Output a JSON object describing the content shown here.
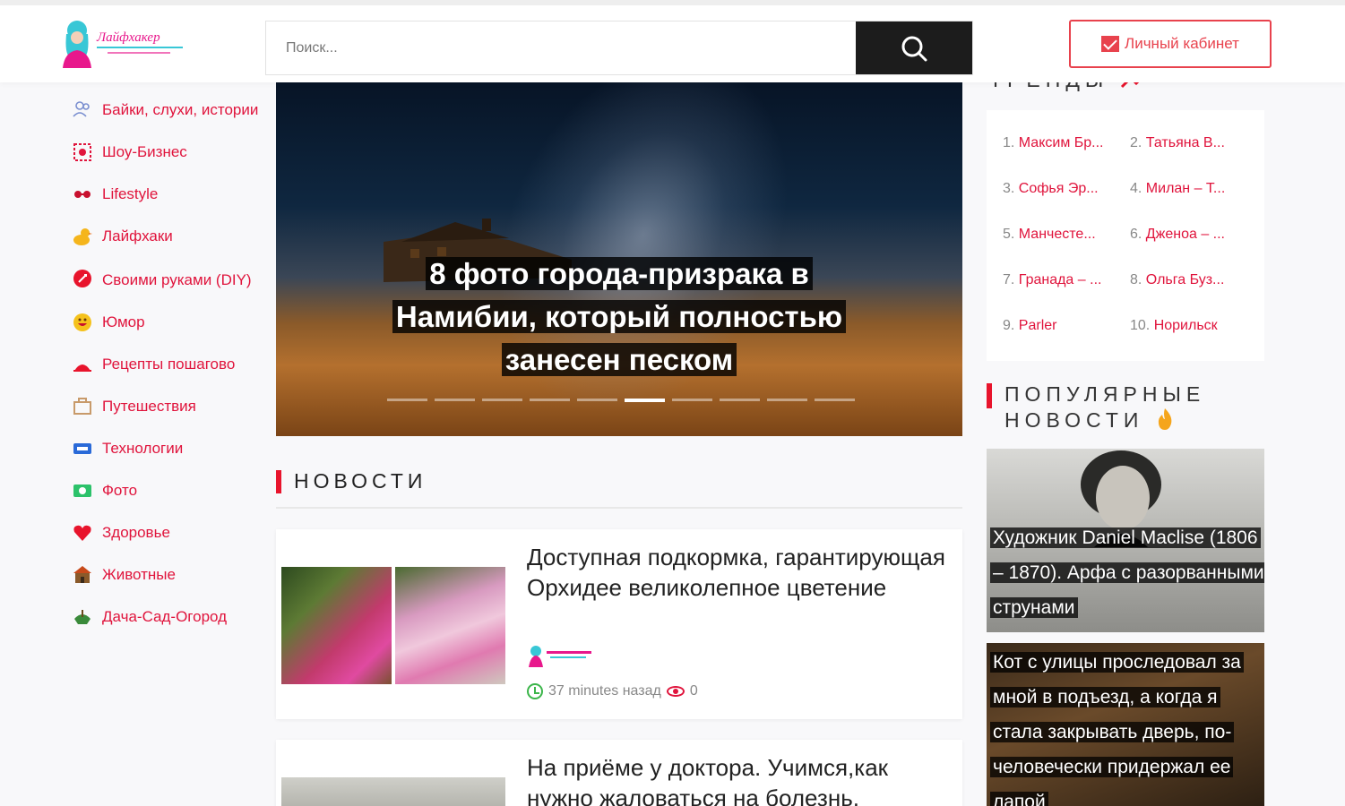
{
  "header": {
    "logo_text": "Лайфхакер",
    "search": {
      "placeholder": "Поиск..."
    },
    "cabinet_label": "Личный кабинет"
  },
  "sidebar": {
    "items": [
      {
        "label": "Байки, слухи, истории",
        "icon": "people-icon"
      },
      {
        "label": "Шоу-Бизнес",
        "icon": "show-icon"
      },
      {
        "label": "Lifestyle",
        "icon": "glasses-icon"
      },
      {
        "label": "Лайфхаки",
        "icon": "duck-icon"
      },
      {
        "label": "Своими руками (DIY)",
        "icon": "diy-icon"
      },
      {
        "label": "Юмор",
        "icon": "smile-icon"
      },
      {
        "label": "Рецепты пошагово",
        "icon": "recipe-icon"
      },
      {
        "label": "Путешествия",
        "icon": "travel-icon"
      },
      {
        "label": "Технологии",
        "icon": "tech-icon"
      },
      {
        "label": "Фото",
        "icon": "photo-icon"
      },
      {
        "label": "Здоровье",
        "icon": "heart-icon"
      },
      {
        "label": "Животные",
        "icon": "animal-icon"
      },
      {
        "label": "Дача-Сад-Огород",
        "icon": "garden-icon"
      }
    ]
  },
  "hero": {
    "title": "8 фото города-призрака в Намибии, который полностью занесен песком",
    "slides_count": 10,
    "active_slide": 6
  },
  "news": {
    "section_title": "НОВОСТИ",
    "items": [
      {
        "title": "Доступная подкормка, гарантирующая Орхидее великолепное цветение",
        "time": "37 minutes назад",
        "views": "0"
      },
      {
        "title": "На приёме у доктора. Учимся,как нужно жаловаться на болезнь,"
      }
    ]
  },
  "trends": {
    "title": "ТРЕНДЫ",
    "items": [
      {
        "num": "1.",
        "label": "Максим Бр..."
      },
      {
        "num": "2.",
        "label": "Татьяна В..."
      },
      {
        "num": "3.",
        "label": "Софья Эр..."
      },
      {
        "num": "4.",
        "label": "Милан – Т..."
      },
      {
        "num": "5.",
        "label": "Манчесте..."
      },
      {
        "num": "6.",
        "label": "Дженоа – ..."
      },
      {
        "num": "7.",
        "label": "Гранада – ..."
      },
      {
        "num": "8.",
        "label": "Ольга Буз..."
      },
      {
        "num": "9.",
        "label": "Parler"
      },
      {
        "num": "10.",
        "label": "Норильск"
      }
    ]
  },
  "popular": {
    "title_line1": "ПОПУЛЯРНЫЕ",
    "title_line2": "НОВОСТИ",
    "items": [
      {
        "title": "Художник Daniel Maclise (1806 – 1870). Арфа с разорванными струнами"
      },
      {
        "title": "Кот с улицы проследовал за мной в подъезд, а когда я стала закрывать дверь, по-человечески придержал ее лапой"
      }
    ]
  },
  "colors": {
    "accent": "#e0143c",
    "header_bg": "#ffffff",
    "search_button": "#1c1c1c",
    "page_bg": "#f8f8fa"
  }
}
